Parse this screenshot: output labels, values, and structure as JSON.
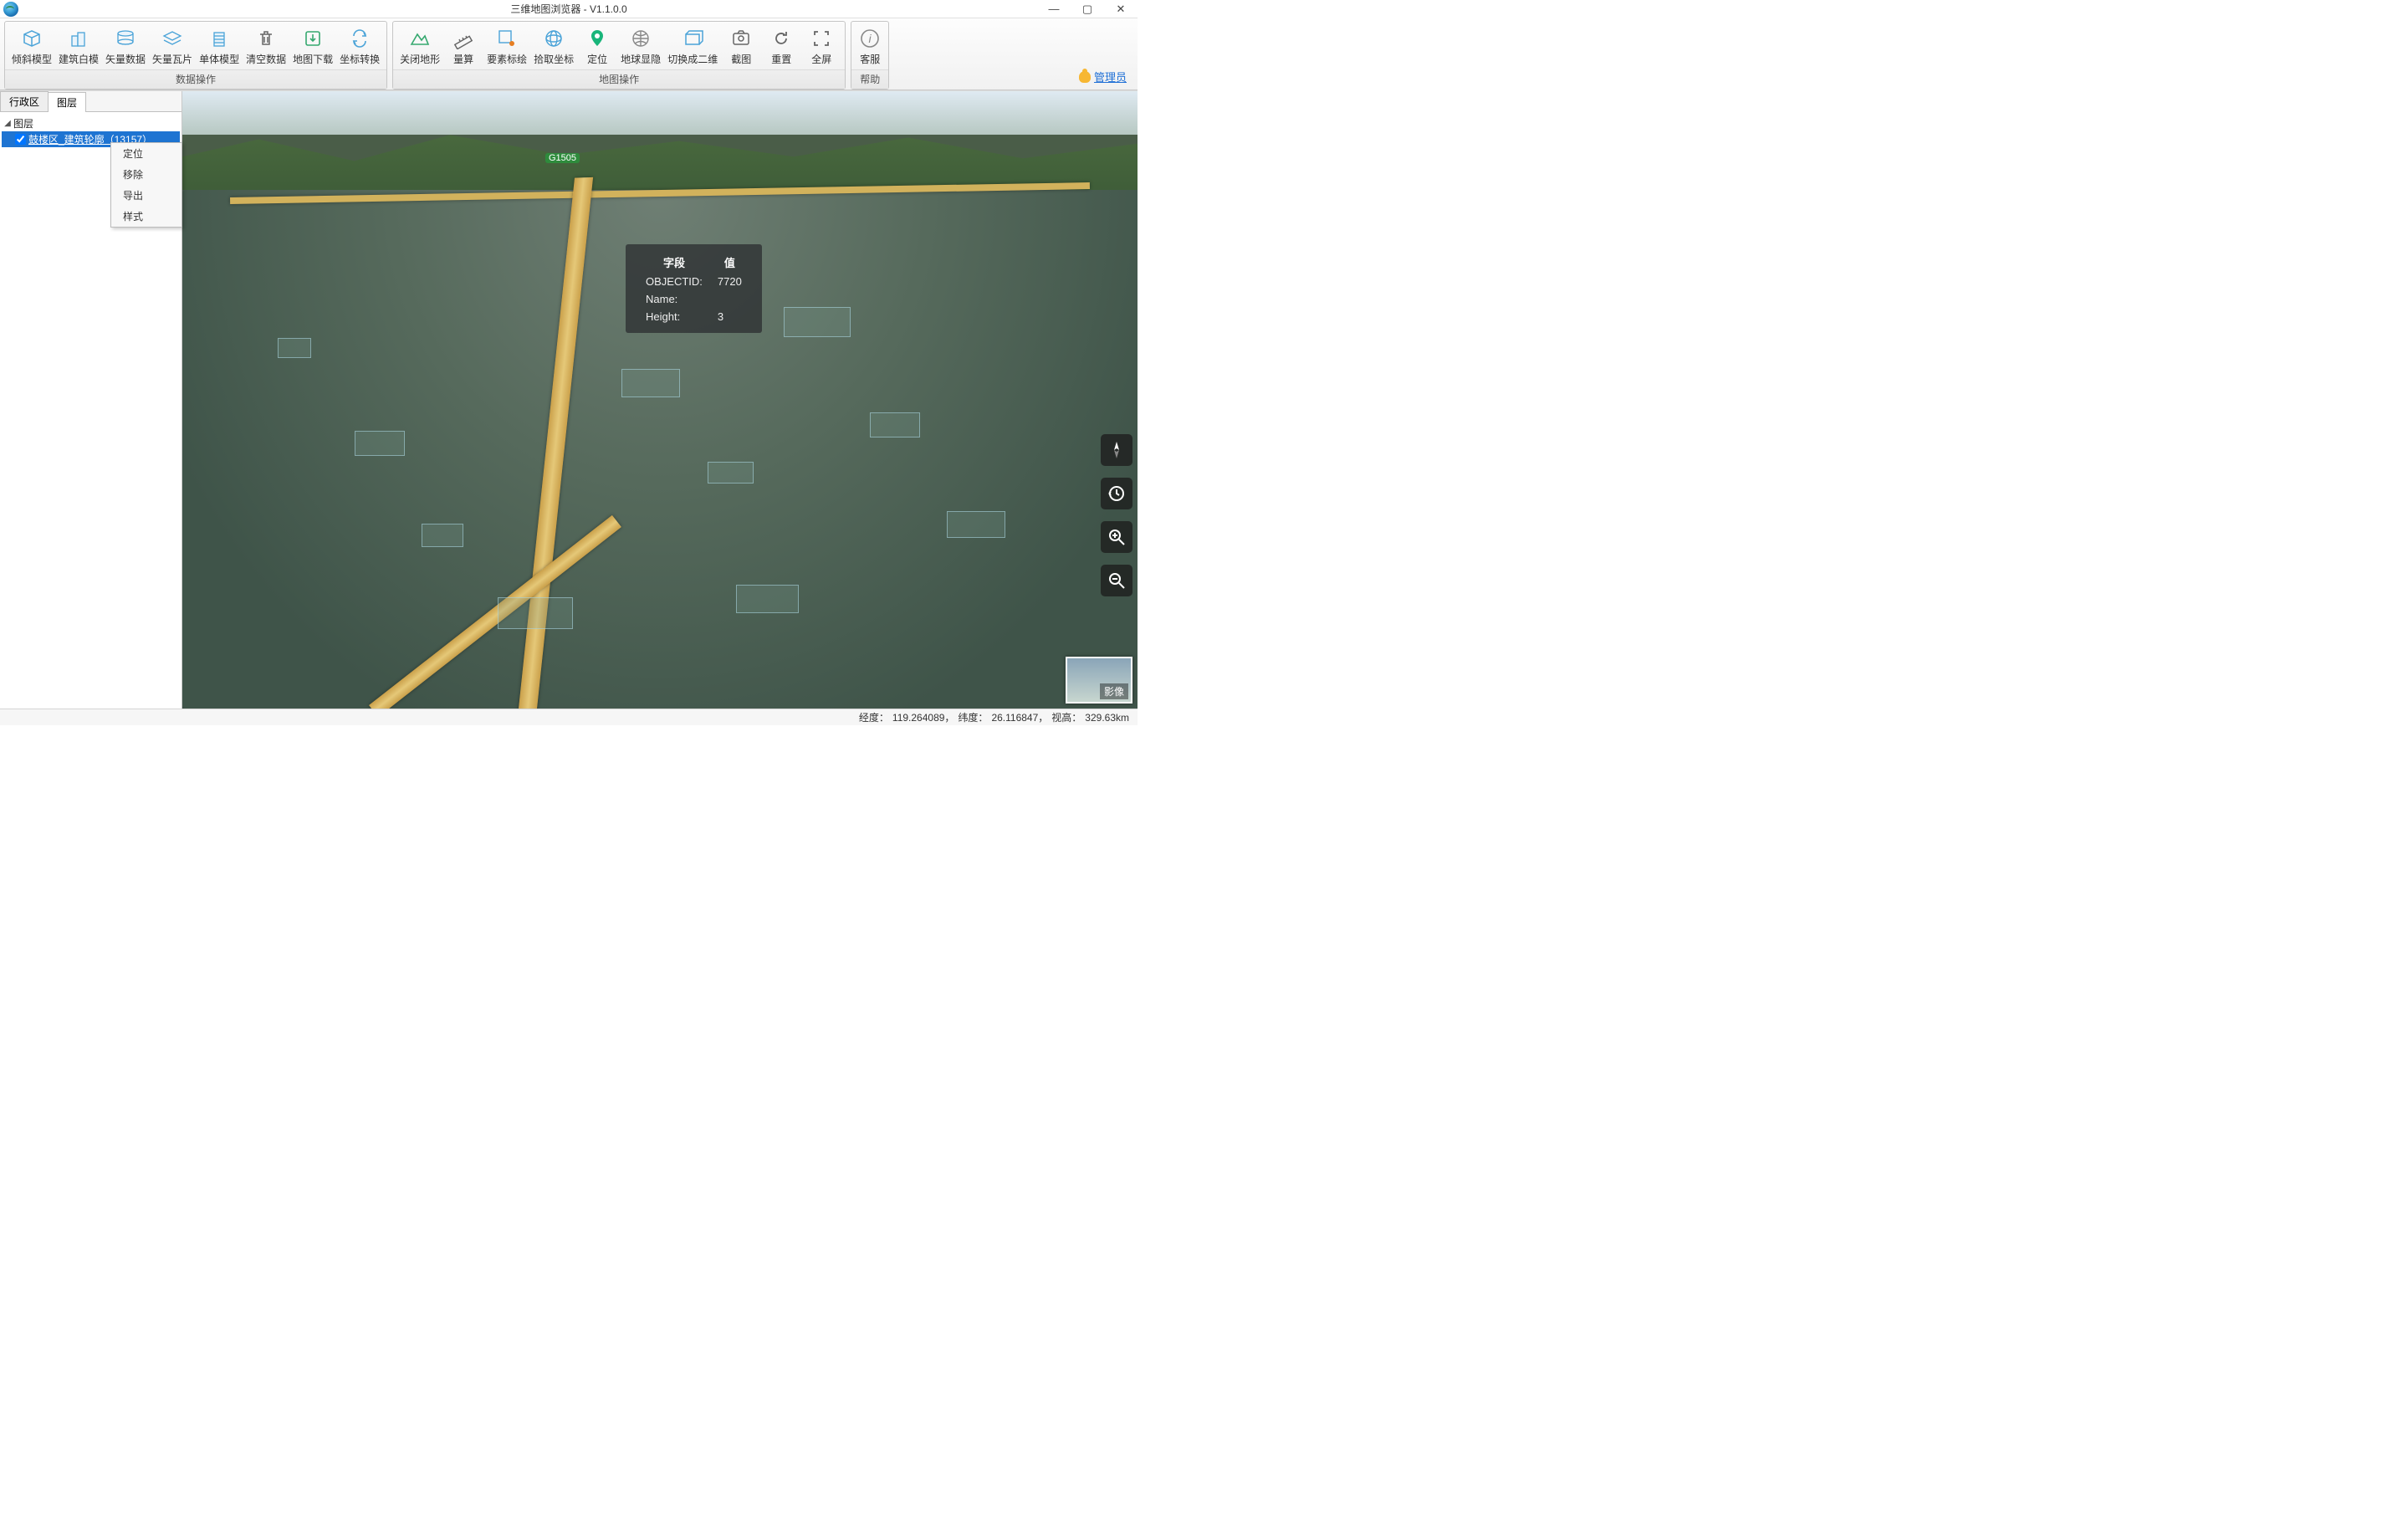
{
  "window": {
    "title": "三维地图浏览器 - V1.1.0.0"
  },
  "ribbon": {
    "group_data_title": "数据操作",
    "group_map_title": "地图操作",
    "group_help_title": "帮助",
    "data_items": [
      {
        "key": "oblique",
        "label": "倾斜模型"
      },
      {
        "key": "whitebuild",
        "label": "建筑白模"
      },
      {
        "key": "vectordata",
        "label": "矢量数据"
      },
      {
        "key": "vectortile",
        "label": "矢量瓦片"
      },
      {
        "key": "singlemodel",
        "label": "单体模型"
      },
      {
        "key": "cleardata",
        "label": "清空数据"
      },
      {
        "key": "mapdl",
        "label": "地图下载"
      },
      {
        "key": "coordconv",
        "label": "坐标转换"
      }
    ],
    "map_items": [
      {
        "key": "terrain",
        "label": "关闭地形"
      },
      {
        "key": "measure",
        "label": "量算"
      },
      {
        "key": "annotate",
        "label": "要素标绘"
      },
      {
        "key": "pickcoord",
        "label": "拾取坐标"
      },
      {
        "key": "locate",
        "label": "定位"
      },
      {
        "key": "globeshow",
        "label": "地球显隐"
      },
      {
        "key": "switch2d",
        "label": "切换成二维"
      },
      {
        "key": "screenshot",
        "label": "截图"
      },
      {
        "key": "reset",
        "label": "重置"
      },
      {
        "key": "fullscreen",
        "label": "全屏"
      }
    ],
    "help_item": {
      "key": "support",
      "label": "客服"
    }
  },
  "admin_link": "管理员",
  "sidebar": {
    "tabs": [
      {
        "key": "district",
        "label": "行政区",
        "active": false
      },
      {
        "key": "layers",
        "label": "图层",
        "active": true
      }
    ],
    "tree_root": "图层",
    "tree_item": {
      "checked": true,
      "label": "鼓楼区_建筑轮廓（13157）"
    },
    "context_menu": [
      "定位",
      "移除",
      "导出",
      "样式"
    ]
  },
  "info_popup": {
    "header_field": "字段",
    "header_value": "值",
    "rows": [
      {
        "field": "OBJECTID:",
        "value": "7720"
      },
      {
        "field": "Name:",
        "value": ""
      },
      {
        "field": "Height:",
        "value": "3"
      }
    ]
  },
  "map_controls": {
    "compass": "compass-icon",
    "history": "history-icon",
    "zoom_in": "zoom-in-icon",
    "zoom_out": "zoom-out-icon"
  },
  "basemap_thumb_label": "影像",
  "status": {
    "lon_label": "经度：",
    "lon": "119.264089，",
    "lat_label": "纬度：",
    "lat": "26.116847，",
    "alt_label": "视高：",
    "alt": "329.63km"
  },
  "road_label": "G1505"
}
